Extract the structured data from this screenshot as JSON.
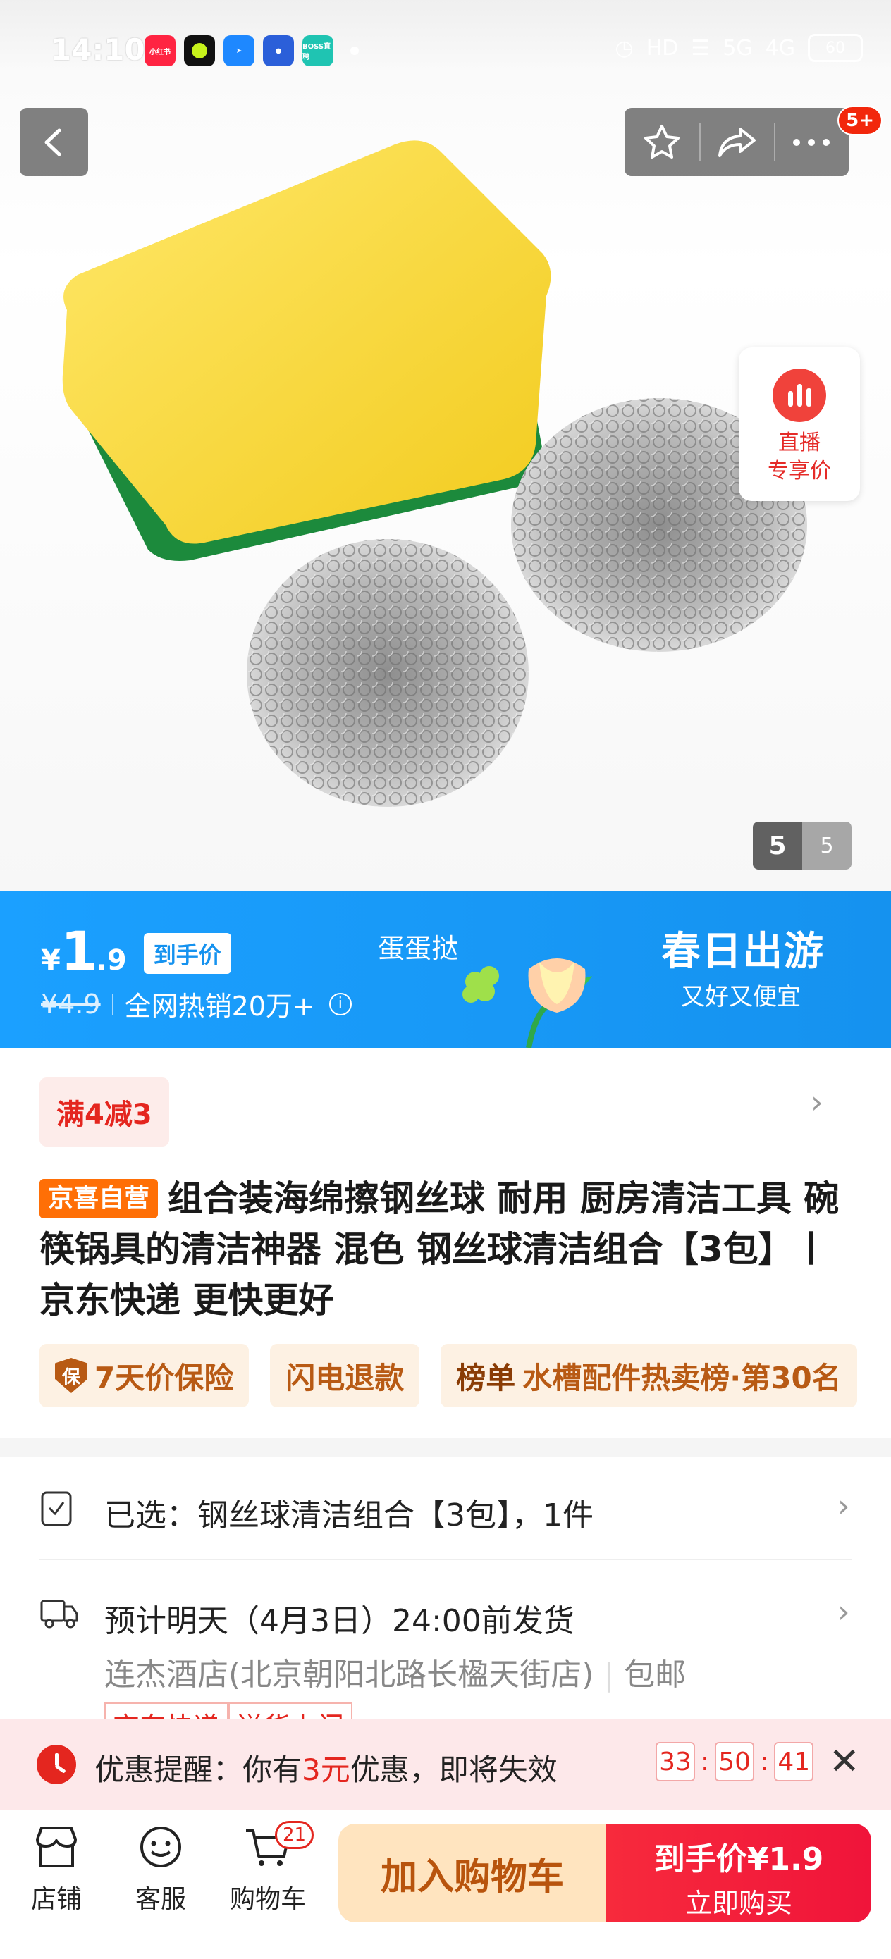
{
  "status_bar": {
    "time": "14:10",
    "apps": [
      {
        "name": "小红书",
        "color": "#ff2442"
      },
      {
        "name": "",
        "color": "#111111"
      },
      {
        "name": "",
        "color": "#1e88ff"
      },
      {
        "name": "",
        "color": "#2b5fd9"
      },
      {
        "name": "BOSS直聘",
        "color": "#1fc4b2"
      }
    ],
    "network": "5G",
    "network2": "4G",
    "battery": "60"
  },
  "top_nav": {
    "notification_badge": "5+"
  },
  "live": {
    "line1": "直播",
    "line2": "专享价"
  },
  "image_counter": {
    "current": "5",
    "total": "5"
  },
  "price_banner": {
    "yen": "¥",
    "price_int": "1",
    "price_dec": ".9",
    "price_tag": "到手价",
    "original_price": "¥4.9",
    "sales": "全网热销20万+",
    "mid_brand": "蛋蛋挞",
    "campaign_title": "春日出游",
    "campaign_sub": "又好又便宜"
  },
  "promo": {
    "label": "满4减3"
  },
  "product": {
    "self_tag": "京喜自营",
    "title": "组合装海绵擦钢丝球 耐用 厨房清洁工具 碗筷锅具的清洁神器 混色 钢丝球清洁组合【3包】丨京东快递 更快更好"
  },
  "service_tags": [
    {
      "icon": "保",
      "text": "7天价保险"
    },
    {
      "text": "闪电退款"
    },
    {
      "prefix": "榜单",
      "text": "水槽配件热卖榜·第30名"
    }
  ],
  "selection": {
    "text": "已选：钢丝球清洁组合【3包】，1件"
  },
  "delivery": {
    "text": "预计明天（4月3日）24:00前发货",
    "address": "连杰酒店(北京朝阳北路长楹天街店)",
    "shipping": "包邮",
    "express_tags": [
      "京东快递",
      "送货上门"
    ]
  },
  "reminder": {
    "prefix": "优惠提醒：你有",
    "amount": "3元",
    "suffix": "优惠，即将失效",
    "countdown": [
      "33",
      "50",
      "41"
    ]
  },
  "bottom_bar": {
    "store": "店铺",
    "service": "客服",
    "cart": "购物车",
    "cart_count": "21",
    "add_to_cart": "加入购物车",
    "buy_top": "到手价¥1.9",
    "buy_bottom": "立即购买"
  }
}
